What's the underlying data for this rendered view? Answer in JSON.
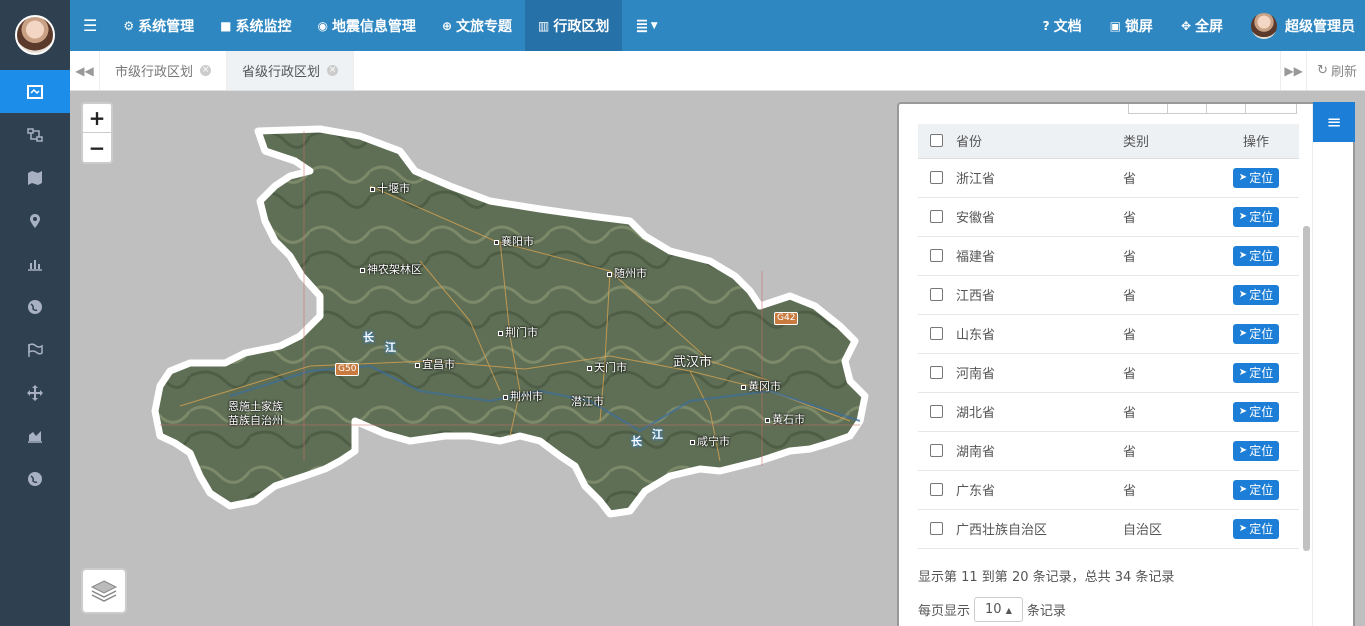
{
  "sidebar": {
    "items": [
      {
        "icon": "map-frame-icon",
        "active": true
      },
      {
        "icon": "nodes-icon",
        "active": false
      },
      {
        "icon": "map-icon",
        "active": false
      },
      {
        "icon": "map-pin-icon",
        "active": false
      },
      {
        "icon": "bar-chart-icon",
        "active": false
      },
      {
        "icon": "globe-icon",
        "active": false
      },
      {
        "icon": "flag-icon",
        "active": false
      },
      {
        "icon": "move-icon",
        "active": false
      },
      {
        "icon": "area-chart-icon",
        "active": false
      },
      {
        "icon": "globe-icon",
        "active": false
      }
    ]
  },
  "topbar": {
    "nav": [
      {
        "label": "系统管理",
        "icon": "gear-icon"
      },
      {
        "label": "系统监控",
        "icon": "video-icon"
      },
      {
        "label": "地震信息管理",
        "icon": "pin-icon"
      },
      {
        "label": "文旅专题",
        "icon": "lifebuoy-icon"
      },
      {
        "label": "行政区划",
        "icon": "bank-icon"
      }
    ],
    "right": {
      "docs": "文档",
      "lock": "锁屏",
      "fullscreen": "全屏",
      "user": "超级管理员"
    }
  },
  "tabs": {
    "items": [
      {
        "label": "市级行政区划"
      },
      {
        "label": "省级行政区划"
      }
    ],
    "refresh": "刷新"
  },
  "map": {
    "zoom_in": "+",
    "zoom_out": "−",
    "cities": [
      "十堰市",
      "襄阳市",
      "神农架林区",
      "随州市",
      "荆门市",
      "天门市",
      "武汉市",
      "宜昌市",
      "黄冈市",
      "荆州市",
      "潜江市",
      "黄石市",
      "恩施土家族",
      "苗族自治州",
      "咸宁市"
    ],
    "rivers": [
      "长",
      "江",
      "长",
      "江"
    ],
    "highways": [
      "G50",
      "G42"
    ]
  },
  "table": {
    "headers": {
      "province": "省份",
      "type": "类别",
      "action": "操作"
    },
    "locate_label": "定位",
    "rows": [
      {
        "province": "浙江省",
        "type": "省"
      },
      {
        "province": "安徽省",
        "type": "省"
      },
      {
        "province": "福建省",
        "type": "省"
      },
      {
        "province": "江西省",
        "type": "省"
      },
      {
        "province": "山东省",
        "type": "省"
      },
      {
        "province": "河南省",
        "type": "省"
      },
      {
        "province": "湖北省",
        "type": "省"
      },
      {
        "province": "湖南省",
        "type": "省"
      },
      {
        "province": "广东省",
        "type": "省"
      },
      {
        "province": "广西壮族自治区",
        "type": "自治区"
      }
    ],
    "pager_text": "显示第 11 到第 20 条记录，总共 34 条记录",
    "page_size_prefix": "每页显示",
    "page_size": "10",
    "page_size_suffix": "条记录"
  },
  "colors": {
    "accent": "#2f87c2",
    "sidebar": "#2f4050",
    "button": "#1c7ed6"
  }
}
